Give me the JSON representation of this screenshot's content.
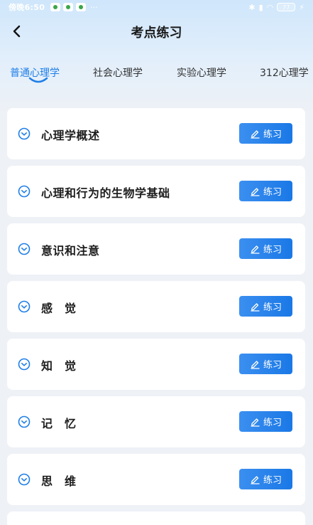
{
  "status_bar": {
    "time": "傍晚6:50",
    "more": "···",
    "battery": "77"
  },
  "nav": {
    "title": "考点练习"
  },
  "tabs": [
    {
      "label": "普通心理学",
      "active": true
    },
    {
      "label": "社会心理学",
      "active": false
    },
    {
      "label": "实验心理学",
      "active": false
    },
    {
      "label": "312心理学",
      "active": false
    }
  ],
  "chapters": [
    {
      "title": "心理学概述",
      "button": "练习"
    },
    {
      "title": "心理和行为的生物学基础",
      "button": "练习"
    },
    {
      "title": "意识和注意",
      "button": "练习"
    },
    {
      "title": "感　觉",
      "button": "练习"
    },
    {
      "title": "知　觉",
      "button": "练习"
    },
    {
      "title": "记　忆",
      "button": "练习"
    },
    {
      "title": "思　维",
      "button": "练习"
    }
  ],
  "colors": {
    "accent": "#1e7ee8",
    "button": "#1a78e6",
    "background": "#eef1f6"
  },
  "icons": {
    "back": "chevron-left-icon",
    "expand": "chevron-down-circle-icon",
    "edit": "pencil-icon"
  }
}
